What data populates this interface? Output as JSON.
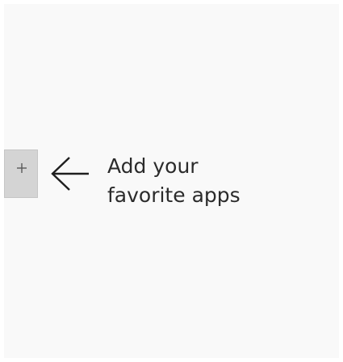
{
  "pin_area": {
    "add_button_icon": "plus-icon",
    "pointer_icon": "arrow-left-icon",
    "hint_line_1": "Add your",
    "hint_line_2": "favorite apps"
  },
  "colors": {
    "panel_background": "#f9f9f9",
    "add_button_background": "#d4d4d4",
    "text": "#2b2b2b",
    "arrow": "#1f1f1f"
  }
}
